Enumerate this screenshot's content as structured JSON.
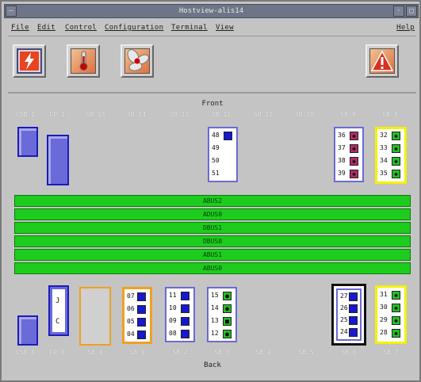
{
  "window": {
    "title": "Hostview-alis14"
  },
  "menubar": {
    "items": [
      {
        "name": "menu-file",
        "label": "File"
      },
      {
        "name": "menu-edit",
        "label": "Edit"
      },
      {
        "name": "menu-control",
        "label": "Control"
      },
      {
        "name": "menu-configuration",
        "label": "Configuration"
      },
      {
        "name": "menu-terminal",
        "label": "Terminal"
      },
      {
        "name": "menu-view",
        "label": "View"
      }
    ],
    "help_label": "Help"
  },
  "toolbar": {
    "buttons": [
      {
        "name": "power-button",
        "icon": "power-icon"
      },
      {
        "name": "temperature-button",
        "icon": "thermometer-icon"
      },
      {
        "name": "fan-button",
        "icon": "fan-icon"
      },
      {
        "name": "alert-button",
        "icon": "warning-icon"
      }
    ]
  },
  "front": {
    "label": "Front",
    "slot_labels": [
      "CSB 1",
      "CP 1",
      "SB 15",
      "SB 14",
      "SB 13",
      "SB 12",
      "SB 11",
      "SB 10",
      "SB 9",
      "SB 8"
    ],
    "sb12_rows": [
      "48",
      "49",
      "50",
      "51"
    ],
    "sb9_rows": [
      "36",
      "37",
      "38",
      "39"
    ],
    "sb8_rows": [
      "32",
      "33",
      "34",
      "35"
    ]
  },
  "buses": [
    "ABUS2",
    "ADUS0",
    "DBUS1",
    "DBUS0",
    "ABUS1",
    "ABUS0"
  ],
  "back": {
    "label": "Back",
    "slot_labels": [
      "CSB 0",
      "CP 0",
      "SB 0",
      "SB 1",
      "SB 2",
      "SB 3",
      "SB 4",
      "SB 5",
      "SB 6",
      "SB 7"
    ],
    "cp0_rows": [
      "J",
      "C"
    ],
    "sb1_rows": [
      "07",
      "06",
      "05",
      "04"
    ],
    "sb2_rows": [
      "11",
      "10",
      "09",
      "08"
    ],
    "sb3_rows": [
      "15",
      "14",
      "13",
      "12"
    ],
    "sb6_rows": [
      "27",
      "26",
      "25",
      "24"
    ],
    "sb7_rows": [
      "31",
      "30",
      "29",
      "28"
    ]
  },
  "colors": {
    "board_blue": "#6a6ad8",
    "board_border": "#1c1cb8",
    "bus_green": "#1dcc1d",
    "led_blue": "#1818d0",
    "led_magenta": "#b02a6a",
    "led_green": "#22c022",
    "highlight_yellow": "#f2f200",
    "highlight_orange": "#f0a020"
  }
}
